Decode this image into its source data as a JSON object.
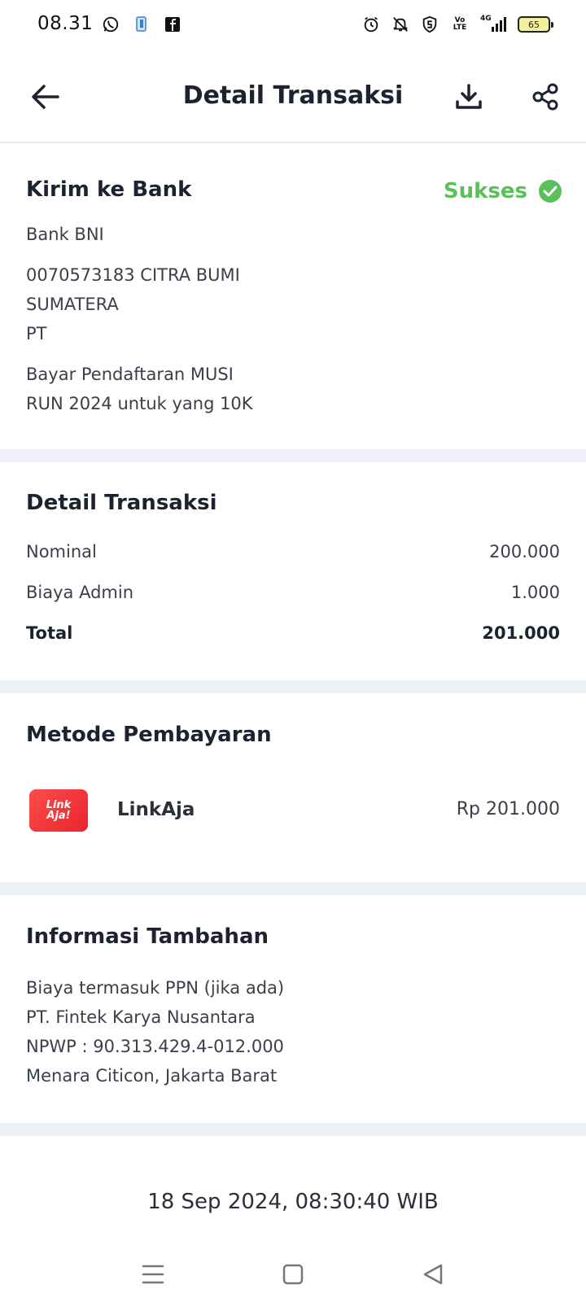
{
  "status_bar": {
    "time": "08.31",
    "battery": "65",
    "network": "4G",
    "volte": "Vo LTE"
  },
  "header": {
    "title": "Detail Transaksi",
    "icons": [
      "back-arrow-icon",
      "download-icon",
      "share-icon"
    ]
  },
  "transfer": {
    "title": "Kirim ke Bank",
    "status": "Sukses",
    "status_color": "#5cc05a",
    "bank": "Bank BNI",
    "account_line1": "0070573183 CITRA BUMI",
    "account_line2": "SUMATERA",
    "account_line3": "PT",
    "note_line1": "Bayar Pendaftaran MUSI",
    "note_line2": "RUN 2024 untuk yang 10K"
  },
  "details": {
    "title": "Detail Transaksi",
    "rows": [
      {
        "label": "Nominal",
        "value": "200.000"
      },
      {
        "label": "Biaya Admin",
        "value": "1.000"
      }
    ],
    "total_label": "Total",
    "total_value": "201.000"
  },
  "payment": {
    "title": "Metode Pembayaran",
    "logo_text_1": "Link",
    "logo_text_2": "Aja!",
    "method": "LinkAja",
    "amount": "Rp 201.000"
  },
  "info": {
    "title": "Informasi Tambahan",
    "lines": [
      "Biaya termasuk PPN (jika ada)",
      "PT. Fintek Karya Nusantara",
      "NPWP : 90.313.429.4-012.000",
      "Menara Citicon, Jakarta Barat"
    ]
  },
  "timestamp": "18 Sep 2024, 08:30:40 WIB",
  "colors": {
    "accent_green": "#5cc05a",
    "divider": "#edf0f6",
    "logo_red": "#e8262d"
  }
}
